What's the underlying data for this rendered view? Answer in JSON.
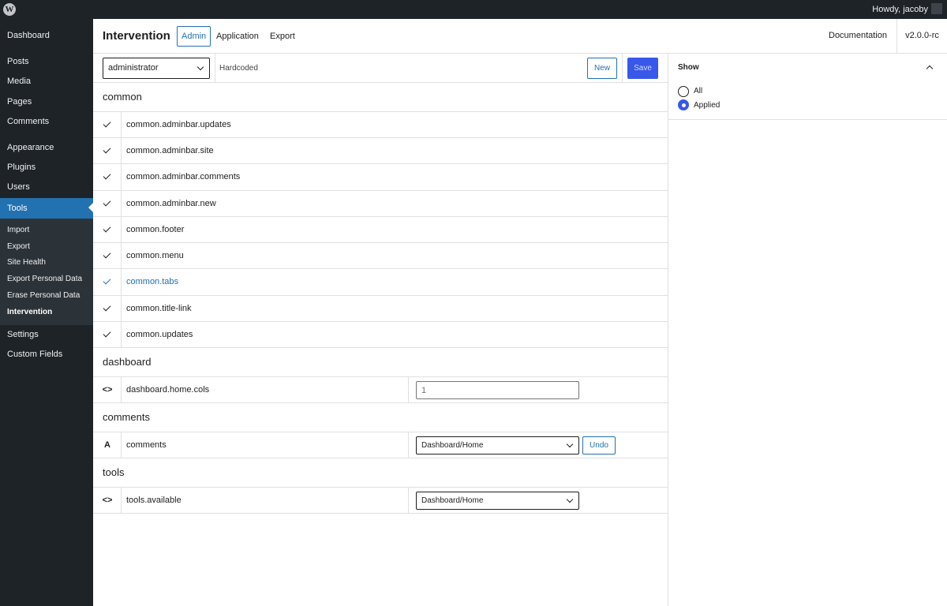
{
  "adminbar": {
    "logo_icon": "wordpress-icon",
    "howdy": "Howdy, jacoby"
  },
  "sidebar": {
    "items": [
      {
        "label": "Dashboard"
      },
      {
        "label": "Posts"
      },
      {
        "label": "Media"
      },
      {
        "label": "Pages"
      },
      {
        "label": "Comments"
      },
      {
        "label": "Appearance"
      },
      {
        "label": "Plugins"
      },
      {
        "label": "Users"
      },
      {
        "label": "Tools"
      },
      {
        "label": "Settings"
      },
      {
        "label": "Custom Fields"
      }
    ],
    "submenu": [
      {
        "label": "Import"
      },
      {
        "label": "Export"
      },
      {
        "label": "Site Health"
      },
      {
        "label": "Export Personal Data"
      },
      {
        "label": "Erase Personal Data"
      },
      {
        "label": "Intervention"
      }
    ]
  },
  "header": {
    "title": "Intervention",
    "tabs": [
      {
        "label": "Admin"
      },
      {
        "label": "Application"
      },
      {
        "label": "Export"
      }
    ],
    "documentation": "Documentation",
    "version": "v2.0.0-rc"
  },
  "toolbar": {
    "role": "administrator",
    "hardcoded": "Hardcoded",
    "new_label": "New",
    "save_label": "Save"
  },
  "panel": {
    "title": "Show",
    "options": [
      {
        "label": "All",
        "checked": false
      },
      {
        "label": "Applied",
        "checked": true
      }
    ]
  },
  "groups": [
    {
      "title": "common",
      "rows": [
        {
          "label": "common.adminbar.updates"
        },
        {
          "label": "common.adminbar.site"
        },
        {
          "label": "common.adminbar.comments"
        },
        {
          "label": "common.adminbar.new"
        },
        {
          "label": "common.footer"
        },
        {
          "label": "common.menu"
        },
        {
          "label": "common.tabs"
        },
        {
          "label": "common.title-link"
        },
        {
          "label": "common.updates"
        }
      ]
    },
    {
      "title": "dashboard",
      "rows": [
        {
          "label": "dashboard.home.cols",
          "icon": "<>",
          "input_placeholder": "1"
        }
      ]
    },
    {
      "title": "comments",
      "rows": [
        {
          "label": "comments",
          "icon": "A",
          "select": "Dashboard/Home",
          "undo": "Undo"
        }
      ]
    },
    {
      "title": "tools",
      "rows": [
        {
          "label": "tools.available",
          "icon": "<>",
          "select": "Dashboard/Home"
        }
      ]
    }
  ]
}
